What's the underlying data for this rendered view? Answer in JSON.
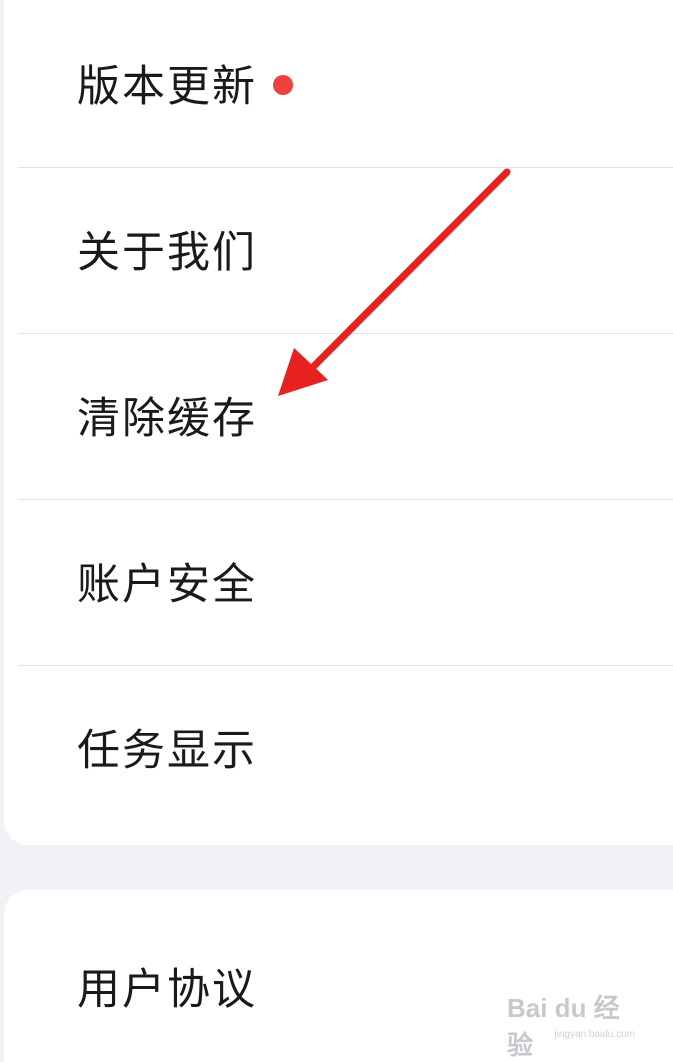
{
  "settings_group_1": {
    "items": [
      {
        "label": "版本更新",
        "has_badge": true
      },
      {
        "label": "关于我们"
      },
      {
        "label": "清除缓存"
      },
      {
        "label": "账户安全"
      },
      {
        "label": "任务显示"
      }
    ]
  },
  "settings_group_2": {
    "items": [
      {
        "label": "用户协议"
      }
    ]
  },
  "annotation": {
    "arrow_color": "#e8211f",
    "points_to": "清除缓存"
  },
  "badge_color": "#f04040",
  "watermark": {
    "brand": "Bai du 经验",
    "sub": "jingyan.baidu.com"
  }
}
